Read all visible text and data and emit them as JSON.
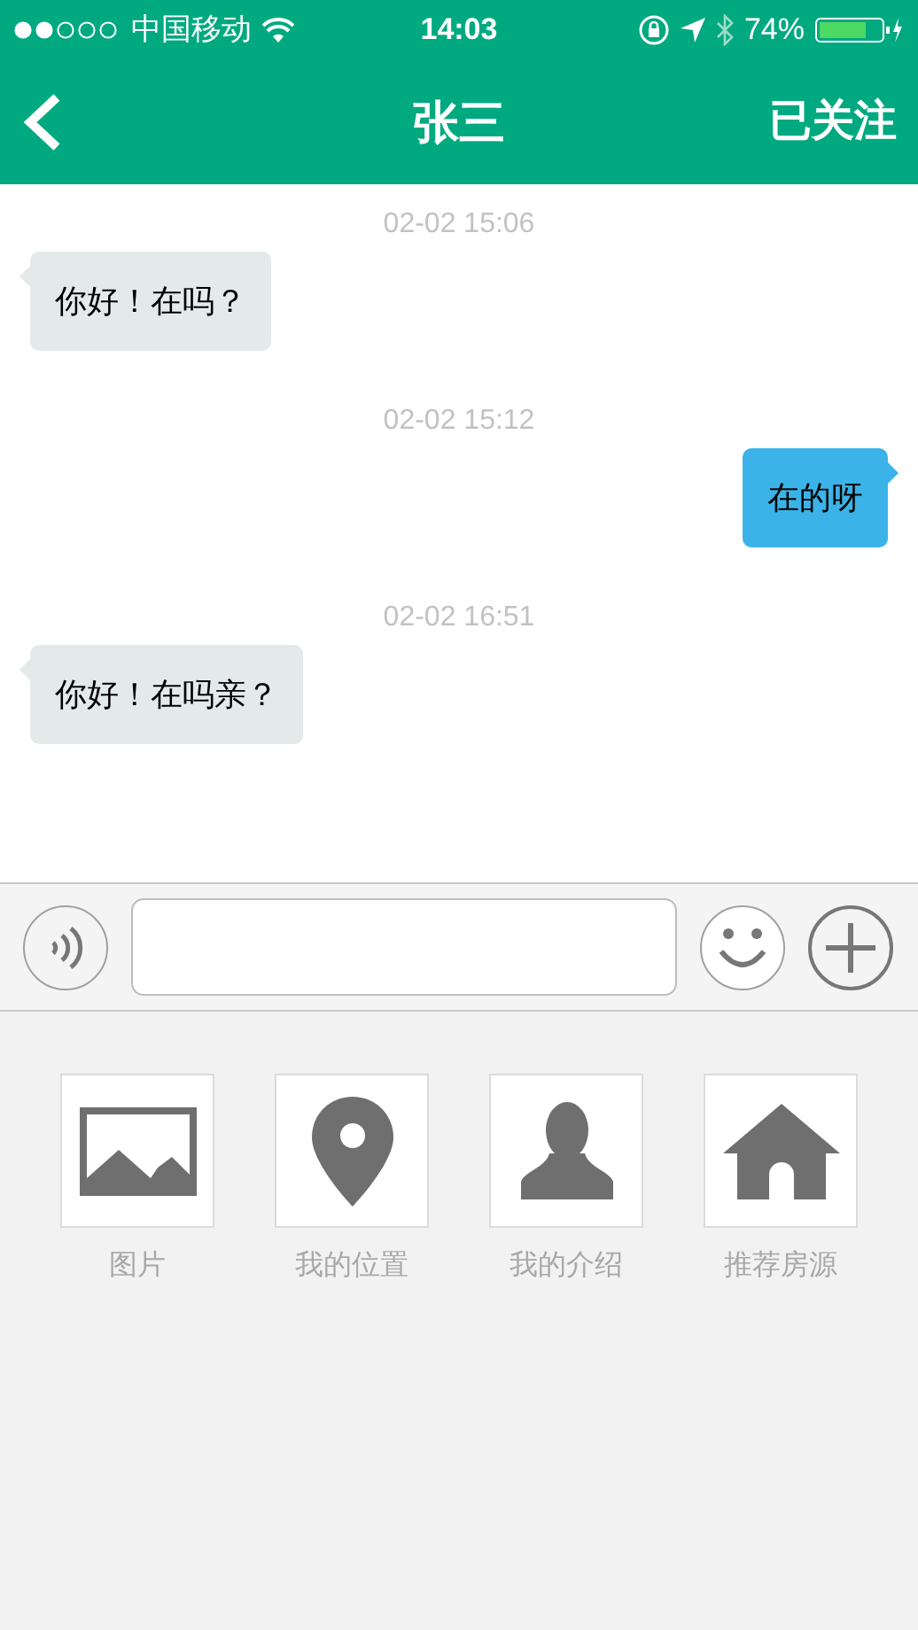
{
  "status_bar": {
    "carrier": "中国移动",
    "time": "14:03",
    "battery": "74%"
  },
  "header": {
    "title": "张三",
    "action": "已关注"
  },
  "messages": [
    {
      "time": "02-02 15:06",
      "kind": "received",
      "text": "你好！在吗？"
    },
    {
      "time": "02-02 15:12",
      "kind": "sent",
      "text": "在的呀"
    },
    {
      "time": "02-02 16:51",
      "kind": "received",
      "text": "你好！在吗亲？"
    }
  ],
  "extras": [
    {
      "kind": "image",
      "label": "图片"
    },
    {
      "kind": "location",
      "label": "我的位置"
    },
    {
      "kind": "profile",
      "label": "我的介绍"
    },
    {
      "kind": "house",
      "label": "推荐房源"
    }
  ]
}
